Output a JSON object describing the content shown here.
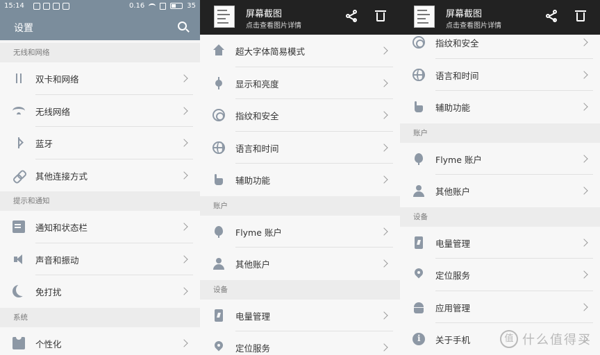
{
  "status_bar": {
    "time": "15:14",
    "percent": "0.16",
    "battery": "35"
  },
  "settings": {
    "title": "设置",
    "sections": [
      {
        "header": "无线和网络",
        "items": [
          {
            "label": "双卡和网络",
            "icon": "dual-sim-icon"
          },
          {
            "label": "无线网络",
            "icon": "wifi-icon"
          },
          {
            "label": "蓝牙",
            "icon": "bluetooth-icon"
          },
          {
            "label": "其他连接方式",
            "icon": "link-icon"
          }
        ]
      },
      {
        "header": "提示和通知",
        "items": [
          {
            "label": "通知和状态栏",
            "icon": "notification-icon"
          },
          {
            "label": "声音和振动",
            "icon": "sound-icon"
          },
          {
            "label": "免打扰",
            "icon": "moon-icon"
          }
        ]
      },
      {
        "header": "系统",
        "items": [
          {
            "label": "个性化",
            "icon": "personalize-icon"
          }
        ]
      }
    ]
  },
  "notification": {
    "title": "屏幕截图",
    "subtitle": "点击查看图片详情"
  },
  "panel2": {
    "items_top": [
      {
        "label": "超大字体简易模式",
        "icon": "home-icon"
      },
      {
        "label": "显示和亮度",
        "icon": "brightness-icon"
      },
      {
        "label": "指纹和安全",
        "icon": "fingerprint-icon"
      },
      {
        "label": "语言和时间",
        "icon": "globe-icon"
      },
      {
        "label": "辅助功能",
        "icon": "hand-icon"
      }
    ],
    "section_account": "账户",
    "account_items": [
      {
        "label": "Flyme 账户",
        "icon": "balloon-icon"
      },
      {
        "label": "其他账户",
        "icon": "person-icon"
      }
    ],
    "section_device": "设备",
    "device_items": [
      {
        "label": "电量管理",
        "icon": "battery-icon"
      },
      {
        "label": "定位服务",
        "icon": "location-pin-icon"
      }
    ]
  },
  "panel3": {
    "items_top": [
      {
        "label": "指纹和安全",
        "icon": "fingerprint-icon"
      },
      {
        "label": "语言和时间",
        "icon": "globe-icon"
      },
      {
        "label": "辅助功能",
        "icon": "hand-icon"
      }
    ],
    "section_account": "账户",
    "account_items": [
      {
        "label": "Flyme 账户",
        "icon": "balloon-icon"
      },
      {
        "label": "其他账户",
        "icon": "person-icon"
      }
    ],
    "section_device": "设备",
    "device_items": [
      {
        "label": "电量管理",
        "icon": "battery-icon"
      },
      {
        "label": "定位服务",
        "icon": "location-pin-icon"
      },
      {
        "label": "应用管理",
        "icon": "android-icon"
      },
      {
        "label": "关于手机",
        "icon": "info-icon"
      }
    ]
  },
  "watermark": {
    "logo": "值",
    "text": "什么值得买"
  },
  "colors": {
    "header_bg": "#7b8d9c",
    "icon": "#8d98a5",
    "notification_bg": "#222222",
    "list_bg": "#f7f7f7",
    "section_bg": "#ececec"
  }
}
